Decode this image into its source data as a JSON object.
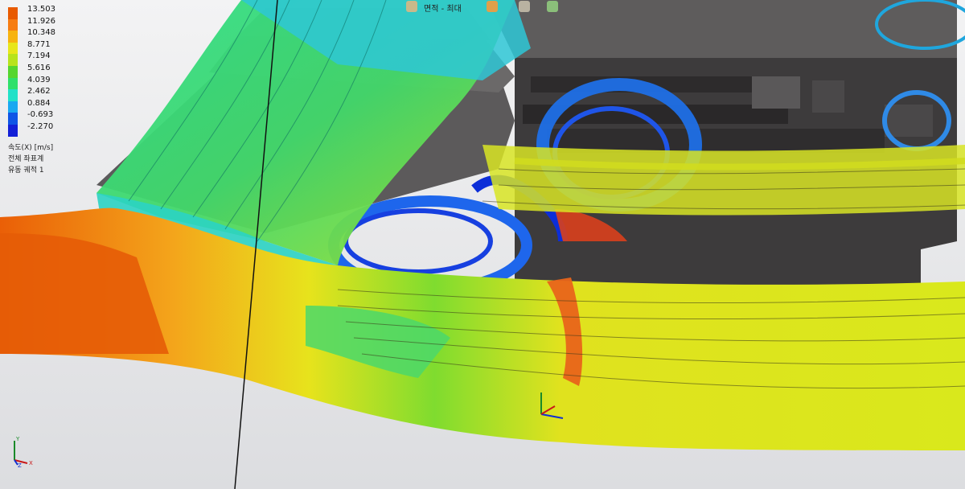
{
  "legend": {
    "values": [
      "13.503",
      "11.926",
      "10.348",
      "8.771",
      "7.194",
      "5.616",
      "4.039",
      "2.462",
      "0.884",
      "-0.693",
      "-2.270"
    ],
    "colors": [
      "#e85a00",
      "#f77d12",
      "#f7b30f",
      "#e8e61a",
      "#b7e31c",
      "#55d62e",
      "#2fe06a",
      "#20e1c8",
      "#19a8f1",
      "#0f55e6",
      "#1320d7"
    ],
    "quantity": "속도(X) [m/s]",
    "coord_system": "전체 좌표계",
    "trajectory": "유동 궤적 1"
  },
  "toolbar": {
    "text_fragment": "면적 - 최대"
  },
  "triad": {
    "x_label": "X",
    "y_label": "Y",
    "z_label": "Z"
  }
}
